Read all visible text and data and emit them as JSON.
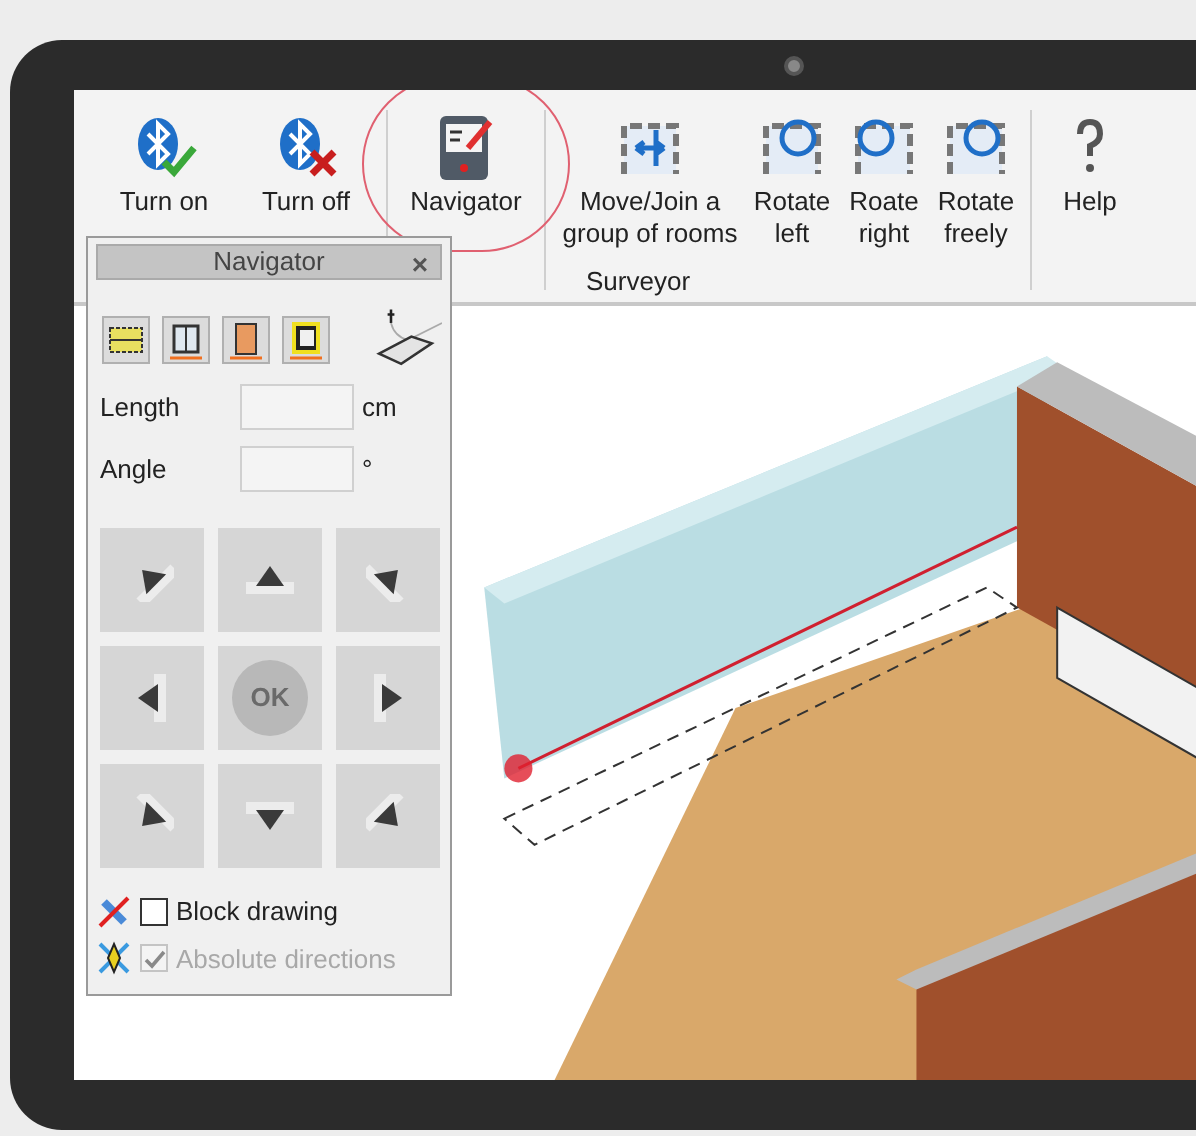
{
  "ribbon": {
    "buttons": [
      {
        "label": "Turn on",
        "kind": "bluetooth-on",
        "highlighted": false
      },
      {
        "label": "Turn off",
        "kind": "bluetooth-off",
        "highlighted": false
      },
      {
        "label": "Navigator",
        "kind": "navigator",
        "highlighted": true
      },
      {
        "label": "Move/Join a group of rooms",
        "kind": "move",
        "highlighted": false
      },
      {
        "label": "Rotate left",
        "kind": "rotate-left",
        "highlighted": false
      },
      {
        "label": "Roate right",
        "kind": "rotate-right",
        "highlighted": false
      },
      {
        "label": "Rotate freely",
        "kind": "rotate-free",
        "highlighted": false
      },
      {
        "label": "Help",
        "kind": "help",
        "highlighted": false
      }
    ],
    "group_label": "Surveyor"
  },
  "navigator": {
    "title": "Navigator",
    "close": "×",
    "tools": [
      {
        "kind": "wall"
      },
      {
        "kind": "window"
      },
      {
        "kind": "door"
      },
      {
        "kind": "room"
      }
    ],
    "fields": [
      {
        "label": "Length",
        "unit": "cm"
      },
      {
        "label": "Angle",
        "unit": "°"
      }
    ],
    "pad": [
      {
        "kind": "up-left"
      },
      {
        "kind": "up"
      },
      {
        "kind": "up-right"
      },
      {
        "kind": "left"
      },
      {
        "kind": "ok",
        "label": "OK"
      },
      {
        "kind": "right"
      },
      {
        "kind": "down-left"
      },
      {
        "kind": "down"
      },
      {
        "kind": "down-right"
      }
    ],
    "options": [
      {
        "label": "Block drawing",
        "checked": false,
        "disabled": false
      },
      {
        "label": "Absolute directions",
        "checked": true,
        "disabled": true
      }
    ]
  }
}
